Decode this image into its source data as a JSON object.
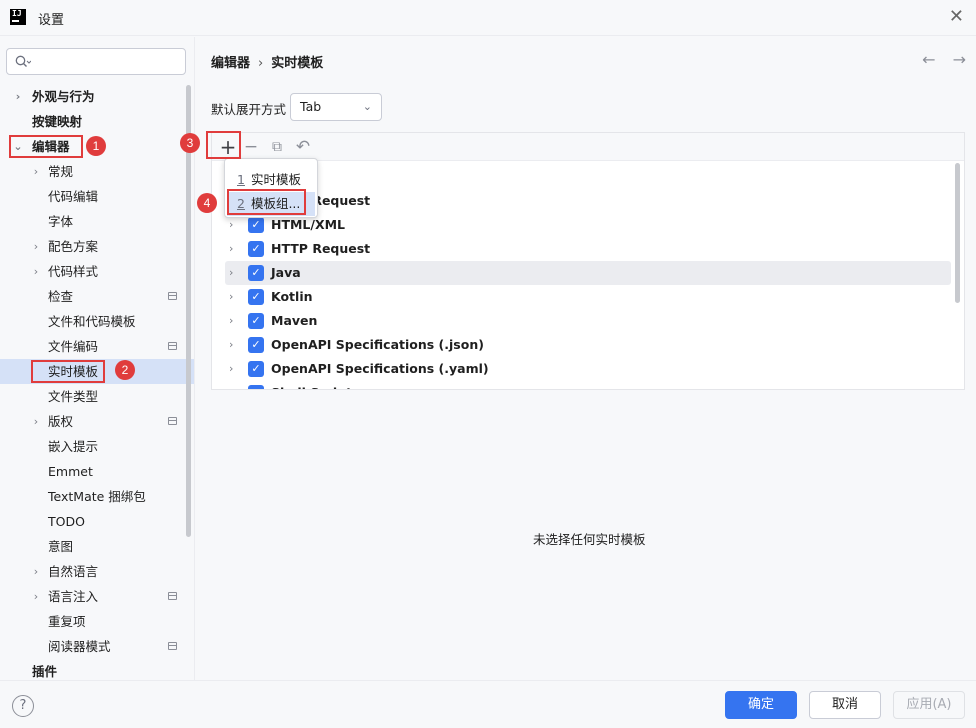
{
  "window": {
    "title": "设置"
  },
  "sidebar": {
    "items": [
      {
        "label": "外观与行为",
        "bold": true,
        "chevron": "›"
      },
      {
        "label": "按键映射",
        "bold": true,
        "chevron": ""
      },
      {
        "label": "编辑器",
        "bold": true,
        "chevron": "⌄"
      },
      {
        "label": "常规",
        "bold": false,
        "chevron": "›"
      },
      {
        "label": "代码编辑",
        "bold": false,
        "chevron": ""
      },
      {
        "label": "字体",
        "bold": false,
        "chevron": ""
      },
      {
        "label": "配色方案",
        "bold": false,
        "chevron": "›"
      },
      {
        "label": "代码样式",
        "bold": false,
        "chevron": "›"
      },
      {
        "label": "检查",
        "bold": false,
        "chevron": ""
      },
      {
        "label": "文件和代码模板",
        "bold": false,
        "chevron": ""
      },
      {
        "label": "文件编码",
        "bold": false,
        "chevron": ""
      },
      {
        "label": "实时模板",
        "bold": false,
        "chevron": ""
      },
      {
        "label": "文件类型",
        "bold": false,
        "chevron": ""
      },
      {
        "label": "版权",
        "bold": false,
        "chevron": "›"
      },
      {
        "label": "嵌入提示",
        "bold": false,
        "chevron": ""
      },
      {
        "label": "Emmet",
        "bold": false,
        "chevron": ""
      },
      {
        "label": "TextMate 捆绑包",
        "bold": false,
        "chevron": ""
      },
      {
        "label": "TODO",
        "bold": false,
        "chevron": ""
      },
      {
        "label": "意图",
        "bold": false,
        "chevron": ""
      },
      {
        "label": "自然语言",
        "bold": false,
        "chevron": "›"
      },
      {
        "label": "语言注入",
        "bold": false,
        "chevron": "›"
      },
      {
        "label": "重复项",
        "bold": false,
        "chevron": ""
      },
      {
        "label": "阅读器模式",
        "bold": false,
        "chevron": ""
      },
      {
        "label": "插件",
        "bold": true,
        "chevron": ""
      }
    ]
  },
  "breadcrumb": {
    "parent": "编辑器",
    "separator": "›",
    "current": "实时模板"
  },
  "nav": {
    "back": "←",
    "forward": "→"
  },
  "expand": {
    "label": "默认展开方式",
    "value": "Tab"
  },
  "toolbar": {
    "add": "+",
    "remove": "−",
    "copy": "⧉",
    "undo": "↶"
  },
  "popup": {
    "items": [
      {
        "num": "1",
        "label": "实时模板"
      },
      {
        "num": "2",
        "label": "模板组..."
      }
    ]
  },
  "templates": {
    "rows": [
      {
        "label": "HTTP Request",
        "checked": true
      },
      {
        "label": "HTML/XML",
        "checked": true
      },
      {
        "label": "HTTP Request",
        "checked": true
      },
      {
        "label": "Java",
        "checked": true
      },
      {
        "label": "Kotlin",
        "checked": true
      },
      {
        "label": "Maven",
        "checked": true
      },
      {
        "label": "OpenAPI Specifications (.json)",
        "checked": true
      },
      {
        "label": "OpenAPI Specifications (.yaml)",
        "checked": true
      },
      {
        "label": "Shell Script",
        "checked": true
      }
    ]
  },
  "empty_message": "未选择任何实时模板",
  "annotations": [
    "1",
    "2",
    "3",
    "4"
  ],
  "footer": {
    "help": "?",
    "ok": "确定",
    "cancel": "取消",
    "apply": "应用(A)"
  },
  "colors": {
    "accent": "#3574f0",
    "annotation_red": "#e03c3c",
    "selection": "#d5e1f7"
  }
}
